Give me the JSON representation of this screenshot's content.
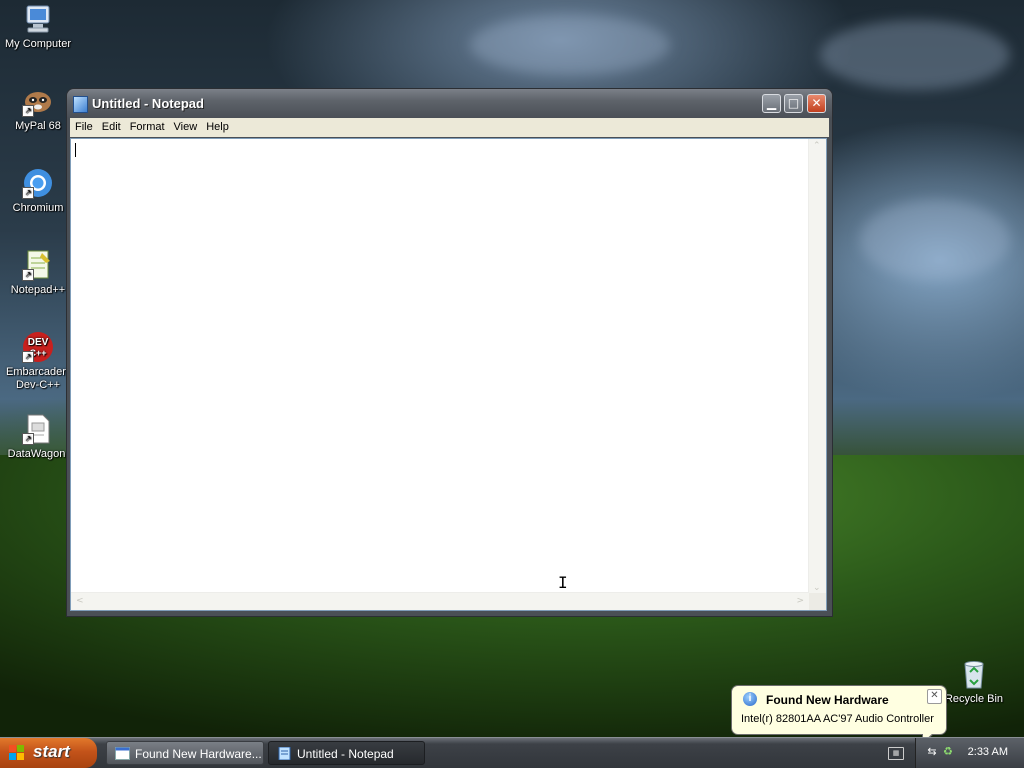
{
  "desktop": {
    "icons": [
      {
        "label": "My Computer",
        "icon": "computer-icon"
      },
      {
        "label": "MyPal 68",
        "icon": "mypal-browser-icon"
      },
      {
        "label": "Chromium",
        "icon": "chromium-icon"
      },
      {
        "label": "Notepad++",
        "icon": "notepadpp-icon"
      },
      {
        "label": "Embarcadero Dev-C++",
        "icon": "devcpp-icon",
        "icon_text": "DEV C++"
      },
      {
        "label": "DataWagon.",
        "icon": "datawagon-file-icon"
      },
      {
        "label": "Recycle Bin",
        "icon": "recycle-bin-icon"
      }
    ]
  },
  "window": {
    "title": "Untitled - Notepad",
    "buttons": {
      "minimize": "▁",
      "maximize": "□",
      "close": "✕"
    },
    "menu": [
      "File",
      "Edit",
      "Format",
      "View",
      "Help"
    ],
    "content": ""
  },
  "balloon": {
    "title": "Found New Hardware",
    "message": "Intel(r) 82801AA AC'97 Audio Controller",
    "close": "✕"
  },
  "taskbar": {
    "start_label": "start",
    "tasks": [
      {
        "label": "Found New Hardware...",
        "active": false
      },
      {
        "label": "Untitled - Notepad",
        "active": true
      }
    ],
    "clock": "2:33 AM"
  },
  "colors": {
    "titlebar": "#5e636a",
    "start_button": "#c3531a",
    "balloon_bg": "#ffffe1",
    "menubar_bg": "#ece9d8"
  }
}
